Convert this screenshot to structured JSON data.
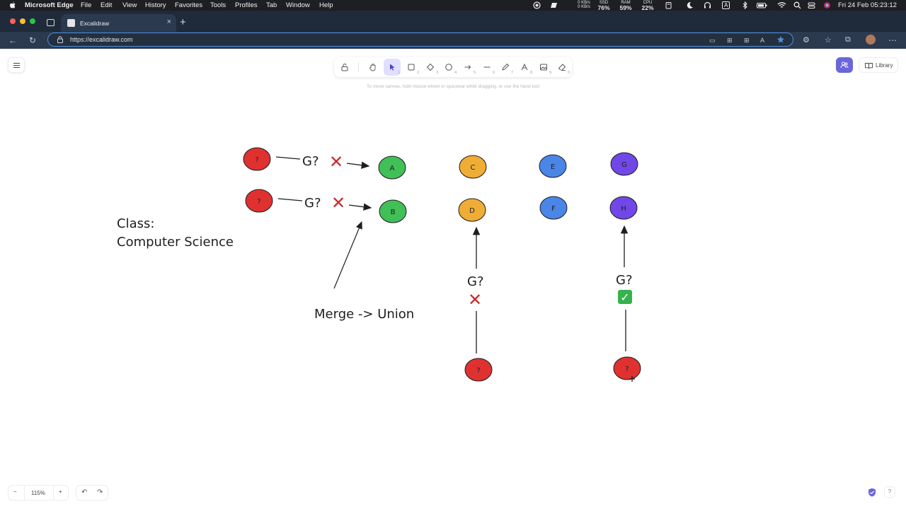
{
  "menubar": {
    "app_name": "Microsoft Edge",
    "menus": [
      "File",
      "Edit",
      "View",
      "History",
      "Favorites",
      "Tools",
      "Profiles",
      "Tab",
      "Window",
      "Help"
    ],
    "net": {
      "up": "0 KB/s",
      "down": "0 KB/s"
    },
    "ssd": {
      "label": "SSD",
      "value": "76%"
    },
    "ram": {
      "label": "RAM",
      "value": "59%"
    },
    "cpu": {
      "label": "CPU",
      "value": "22%"
    },
    "input_indicator": "A",
    "datetime": "Fri 24 Feb  05:23:12"
  },
  "browser": {
    "tab_title": "Excalidraw",
    "url": "https://excalidraw.com"
  },
  "excalidraw": {
    "hint": "To move canvas, hold mouse wheel or spacebar while dragging, or use the hand tool",
    "tools": [
      {
        "name": "lock",
        "key": ""
      },
      {
        "name": "hand",
        "key": ""
      },
      {
        "name": "selection",
        "key": "1"
      },
      {
        "name": "rectangle",
        "key": "2"
      },
      {
        "name": "diamond",
        "key": "3"
      },
      {
        "name": "ellipse",
        "key": "4"
      },
      {
        "name": "arrow",
        "key": "5"
      },
      {
        "name": "line",
        "key": "6"
      },
      {
        "name": "draw",
        "key": "7"
      },
      {
        "name": "text",
        "key": "8"
      },
      {
        "name": "image",
        "key": "9"
      },
      {
        "name": "eraser",
        "key": "0"
      }
    ],
    "library_label": "Library",
    "zoom": "115%",
    "zoom_out": "−",
    "zoom_in": "+",
    "undo": "↶",
    "redo": "↷",
    "help": "?"
  },
  "drawing": {
    "class_line1": "Class:",
    "class_line2": "Computer Science",
    "merge_label": "Merge -> Union",
    "unknown": "?",
    "g_question": "G?",
    "cross": "✕",
    "check": "✓",
    "nodes": {
      "A": "A",
      "B": "B",
      "C": "C",
      "D": "D",
      "E": "E",
      "F": "F",
      "G": "G",
      "H": "H"
    },
    "colors": {
      "red": "#e03131",
      "green": "#40c057",
      "orange": "#f0ad35",
      "blue": "#4a86e8",
      "purple": "#7048e8",
      "cross_red": "#c92a2a",
      "check_green": "#37b24d"
    }
  }
}
